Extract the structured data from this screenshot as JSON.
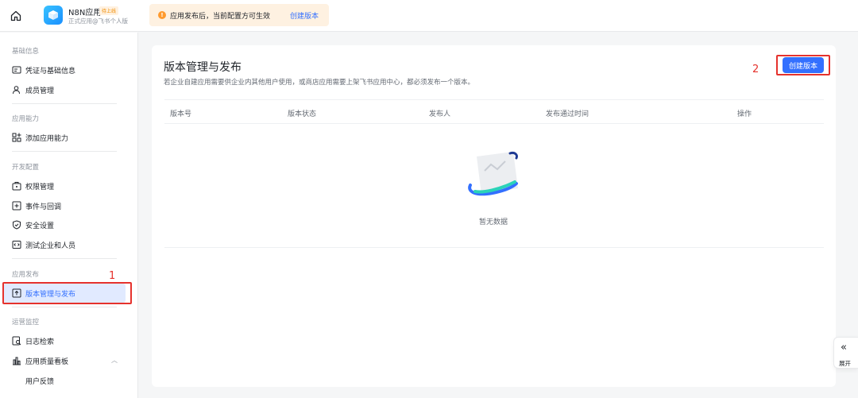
{
  "header": {
    "app_name": "N8N应用",
    "app_badge": "待上线",
    "app_sub": "正式应用@飞书个人版",
    "notice_text": "应用发布后，当前配置方可生效",
    "notice_link": "创建版本",
    "notice_icon_glyph": "!"
  },
  "sidebar": {
    "sections": {
      "basic": "基础信息",
      "ability": "应用能力",
      "dev": "开发配置",
      "publish": "应用发布",
      "ops": "运营监控"
    },
    "items": {
      "credentials": "凭证与基础信息",
      "members": "成员管理",
      "add_ability": "添加应用能力",
      "permissions": "权限管理",
      "events": "事件与回调",
      "security": "安全设置",
      "test_org": "测试企业和人员",
      "version": "版本管理与发布",
      "log_search": "日志检索",
      "quality": "应用质量看板",
      "feedback": "用户反馈"
    }
  },
  "main": {
    "title": "版本管理与发布",
    "description": "若企业自建应用需要供企业内其他用户使用，或商店应用需要上架飞书应用中心，都必须发布一个版本。",
    "create_button": "创建版本",
    "columns": [
      "版本号",
      "版本状态",
      "发布人",
      "发布通过时间",
      "操作"
    ],
    "empty_text": "暂无数据"
  },
  "annotations": {
    "one": "1",
    "two": "2"
  },
  "expand": {
    "icon": "«",
    "label": "展开"
  },
  "colors": {
    "accent": "#3370ff",
    "annotation": "#e5322d",
    "notice_bg": "#fef1e1"
  }
}
